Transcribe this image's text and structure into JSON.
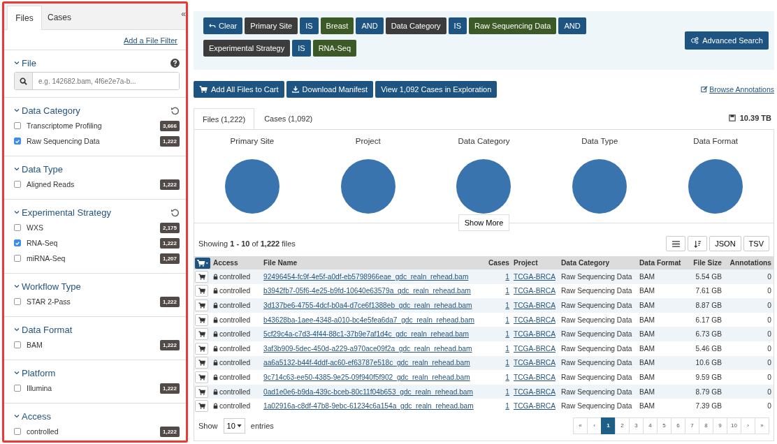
{
  "sidebar": {
    "tabs": [
      {
        "label": "Files",
        "selected": true
      },
      {
        "label": "Cases",
        "selected": false
      }
    ],
    "collapse_glyph": "«",
    "add_filter_link": "Add a File Filter",
    "file_section": {
      "title": "File",
      "placeholder": "e.g. 142682.bam, 4f6e2e7a-b..."
    },
    "facets": [
      {
        "title": "Data Category",
        "resettable": true,
        "items": [
          {
            "label": "Transcriptome Profiling",
            "checked": false,
            "count": "3,666"
          },
          {
            "label": "Raw Sequencing Data",
            "checked": true,
            "count": "1,222"
          }
        ]
      },
      {
        "title": "Data Type",
        "resettable": false,
        "items": [
          {
            "label": "Aligned Reads",
            "checked": false,
            "count": "1,222"
          }
        ]
      },
      {
        "title": "Experimental Strategy",
        "resettable": true,
        "items": [
          {
            "label": "WXS",
            "checked": false,
            "count": "2,175"
          },
          {
            "label": "RNA-Seq",
            "checked": true,
            "count": "1,222"
          },
          {
            "label": "miRNA-Seq",
            "checked": false,
            "count": "1,207"
          }
        ]
      },
      {
        "title": "Workflow Type",
        "resettable": false,
        "items": [
          {
            "label": "STAR 2-Pass",
            "checked": false,
            "count": "1,222"
          }
        ]
      },
      {
        "title": "Data Format",
        "resettable": false,
        "items": [
          {
            "label": "BAM",
            "checked": false,
            "count": "1,222"
          }
        ]
      },
      {
        "title": "Platform",
        "resettable": false,
        "items": [
          {
            "label": "Illumina",
            "checked": false,
            "count": "1,222"
          }
        ]
      },
      {
        "title": "Access",
        "resettable": false,
        "items": [
          {
            "label": "controlled",
            "checked": false,
            "count": "1,222"
          }
        ]
      }
    ]
  },
  "query": {
    "terms": [
      {
        "text": "Clear",
        "kind": "clear"
      },
      {
        "text": "Primary Site",
        "kind": "field"
      },
      {
        "text": "IS",
        "kind": "op"
      },
      {
        "text": "Breast",
        "kind": "value"
      },
      {
        "text": "AND",
        "kind": "op"
      },
      {
        "text": "Data Category",
        "kind": "field"
      },
      {
        "text": "IS",
        "kind": "op"
      },
      {
        "text": "Raw Sequencing Data",
        "kind": "value"
      },
      {
        "text": "AND",
        "kind": "op"
      },
      {
        "text": "Experimental Strategy",
        "kind": "field"
      },
      {
        "text": "IS",
        "kind": "op"
      },
      {
        "text": "RNA-Seq",
        "kind": "value"
      }
    ],
    "advanced_search": "Advanced Search"
  },
  "actions": [
    {
      "label": "Add All Files to Cart",
      "kind": "cart"
    },
    {
      "label": "Download Manifest",
      "kind": "download"
    },
    {
      "label": "View 1,092 Cases in Exploration",
      "kind": "plain"
    }
  ],
  "browse_annotations": "Browse Annotations",
  "tabs": [
    {
      "label": "Files (1,222)",
      "selected": true
    },
    {
      "label": "Cases (1,092)",
      "selected": false
    }
  ],
  "total_size": "10.39 TB",
  "charts": [
    "Primary Site",
    "Project",
    "Data Category",
    "Data Type",
    "Data Format"
  ],
  "show_more": "Show More",
  "showing": "Showing **1 - 10** of **1,222** files",
  "export_buttons": [
    "JSON",
    "TSV"
  ],
  "table": {
    "columns": [
      "Access",
      "File Name",
      "Cases",
      "Project",
      "Data Category",
      "Data Format",
      "File Size",
      "Annotations"
    ],
    "rows": [
      {
        "access": "controlled",
        "file_name": "92496454-fc9f-4e5f-a0df-eb5798966eae_gdc_realn_rehead.bam",
        "cases": "1",
        "project": "TCGA-BRCA",
        "data_category": "Raw Sequencing Data",
        "data_format": "BAM",
        "file_size": "5.54 GB",
        "annotations": "0"
      },
      {
        "access": "controlled",
        "file_name": "b3942fb7-05f6-4e25-b9fd-10640e63579a_gdc_realn_rehead.bam",
        "cases": "1",
        "project": "TCGA-BRCA",
        "data_category": "Raw Sequencing Data",
        "data_format": "BAM",
        "file_size": "7.61 GB",
        "annotations": "0"
      },
      {
        "access": "controlled",
        "file_name": "3d137be6-4755-4dcf-b0a4-d7ce6f1388eb_gdc_realn_rehead.bam",
        "cases": "1",
        "project": "TCGA-BRCA",
        "data_category": "Raw Sequencing Data",
        "data_format": "BAM",
        "file_size": "8.87 GB",
        "annotations": "0"
      },
      {
        "access": "controlled",
        "file_name": "b43628ba-1aee-4348-a010-bc4e5fea6da7_gdc_realn_rehead.bam",
        "cases": "1",
        "project": "TCGA-BRCA",
        "data_category": "Raw Sequencing Data",
        "data_format": "BAM",
        "file_size": "6.17 GB",
        "annotations": "0"
      },
      {
        "access": "controlled",
        "file_name": "5cf29c4a-c7d3-4f44-88c1-37b9e7af1d4c_gdc_realn_rehead.bam",
        "cases": "1",
        "project": "TCGA-BRCA",
        "data_category": "Raw Sequencing Data",
        "data_format": "BAM",
        "file_size": "6.73 GB",
        "annotations": "0"
      },
      {
        "access": "controlled",
        "file_name": "3af3b909-5dec-450d-a229-a970ace09f2a_gdc_realn_rehead.bam",
        "cases": "1",
        "project": "TCGA-BRCA",
        "data_category": "Raw Sequencing Data",
        "data_format": "BAM",
        "file_size": "5.46 GB",
        "annotations": "0"
      },
      {
        "access": "controlled",
        "file_name": "aa6a5132-b44f-4ddf-ac60-ef63787e518c_gdc_realn_rehead.bam",
        "cases": "1",
        "project": "TCGA-BRCA",
        "data_category": "Raw Sequencing Data",
        "data_format": "BAM",
        "file_size": "10.6 GB",
        "annotations": "0"
      },
      {
        "access": "controlled",
        "file_name": "9c714c63-ee50-4385-9e25-09f940f5f902_gdc_realn_rehead.bam",
        "cases": "1",
        "project": "TCGA-BRCA",
        "data_category": "Raw Sequencing Data",
        "data_format": "BAM",
        "file_size": "9.59 GB",
        "annotations": "0"
      },
      {
        "access": "controlled",
        "file_name": "0ad1e0e6-b9da-439c-bceb-80c11f04b653_gdc_realn_rehead.bam",
        "cases": "1",
        "project": "TCGA-BRCA",
        "data_category": "Raw Sequencing Data",
        "data_format": "BAM",
        "file_size": "8.79 GB",
        "annotations": "0"
      },
      {
        "access": "controlled",
        "file_name": "1a02916a-c8df-47b8-9ebc-61234c6a154a_gdc_realn_rehead.bam",
        "cases": "1",
        "project": "TCGA-BRCA",
        "data_category": "Raw Sequencing Data",
        "data_format": "BAM",
        "file_size": "7.39 GB",
        "annotations": "0"
      }
    ]
  },
  "footer": {
    "show": "Show",
    "page_size": "10",
    "entries": "entries",
    "pages": [
      {
        "label": "«",
        "selected": false
      },
      {
        "label": "‹",
        "selected": false
      },
      {
        "label": "1",
        "selected": true
      },
      {
        "label": "2",
        "selected": false
      },
      {
        "label": "3",
        "selected": false
      },
      {
        "label": "4",
        "selected": false
      },
      {
        "label": "5",
        "selected": false
      },
      {
        "label": "6",
        "selected": false
      },
      {
        "label": "7",
        "selected": false
      },
      {
        "label": "8",
        "selected": false
      },
      {
        "label": "9",
        "selected": false
      },
      {
        "label": "10",
        "selected": false
      },
      {
        "label": "›",
        "selected": false
      },
      {
        "label": "»",
        "selected": false
      }
    ]
  }
}
